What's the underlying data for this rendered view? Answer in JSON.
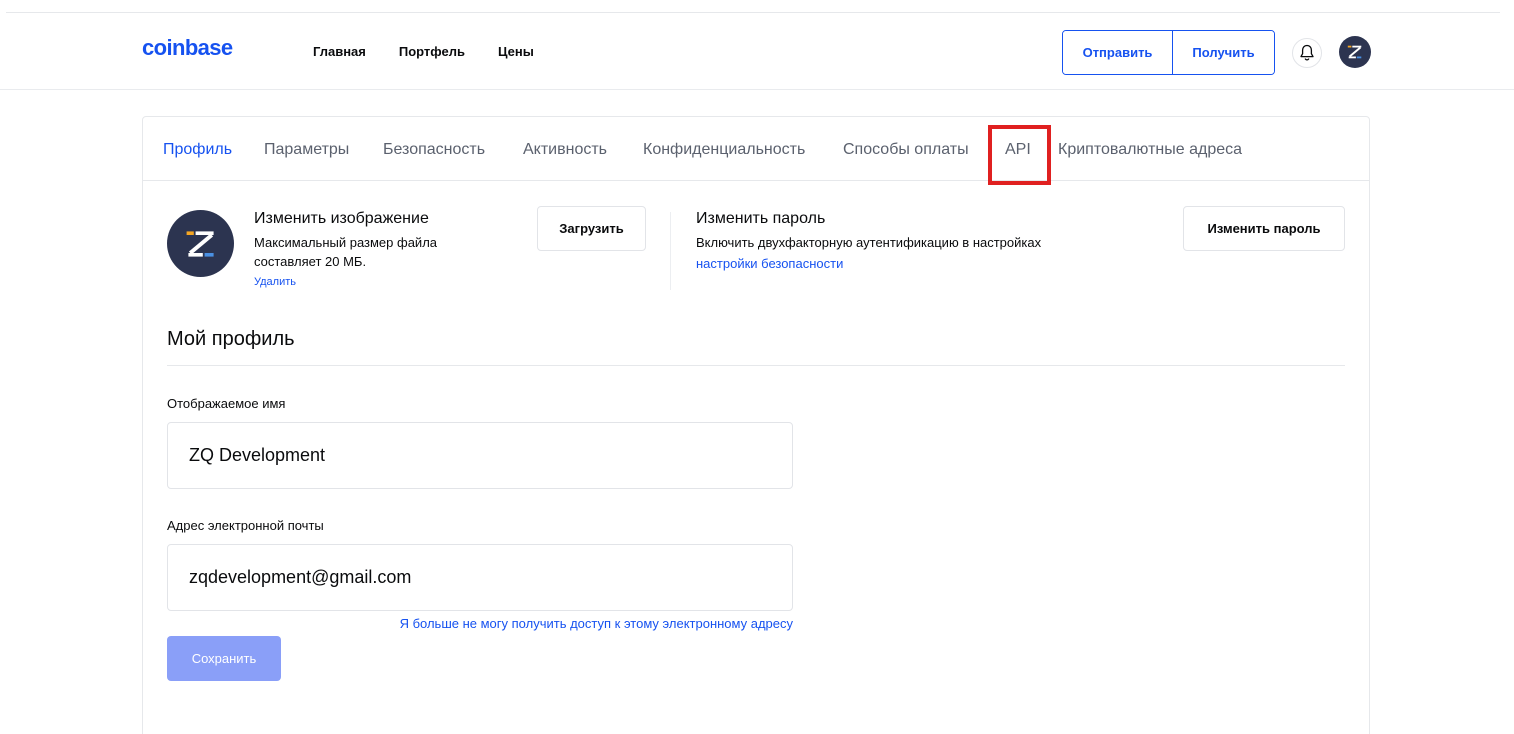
{
  "colors": {
    "brand": "#1652f0",
    "highlight": "#e02020",
    "save_disabled": "#8a9ff8",
    "avatar_bg": "#2c3450"
  },
  "header": {
    "logo": "coinbase",
    "nav": [
      "Главная",
      "Портфель",
      "Цены"
    ],
    "send_label": "Отправить",
    "receive_label": "Получить",
    "notification_icon": "bell-icon",
    "avatar_icon": "zq-logo-icon"
  },
  "tabs": {
    "items": [
      "Профиль",
      "Параметры",
      "Безопасность",
      "Активность",
      "Конфиденциальность",
      "Способы оплаты",
      "API",
      "Криптовалютные адреса"
    ],
    "active": "Профиль",
    "highlighted": "API"
  },
  "image_section": {
    "title": "Изменить изображение",
    "description": "Максимальный размер файла составляет 20 МБ.",
    "remove_label": "Удалить",
    "upload_label": "Загрузить"
  },
  "password_section": {
    "title": "Изменить пароль",
    "description": "Включить двухфакторную аутентификацию в настройках",
    "link_label": "настройки безопасности",
    "button_label": "Изменить пароль"
  },
  "profile": {
    "title": "Мой профиль",
    "display_name_label": "Отображаемое имя",
    "display_name_value": "ZQ Development",
    "email_label": "Адрес электронной почты",
    "email_value": "zqdevelopment@gmail.com",
    "lost_email_link": "Я больше не могу получить доступ к этому электронному адресу",
    "save_label": "Сохранить"
  }
}
